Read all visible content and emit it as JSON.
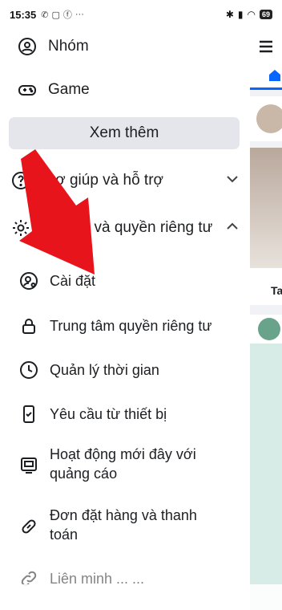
{
  "status_bar": {
    "time": "15:35",
    "battery": "69"
  },
  "menu": {
    "groups": "Nhóm",
    "game": "Game",
    "see_more": "Xem thêm",
    "help": "Trợ giúp và hỗ trợ",
    "settings_privacy": "Cài đặt và quyền riêng tư"
  },
  "submenu": [
    {
      "label": "Cài đặt",
      "icon": "user-gear-icon"
    },
    {
      "label": "Trung tâm quyền riêng tư",
      "icon": "lock-icon"
    },
    {
      "label": "Quản lý thời gian",
      "icon": "clock-icon"
    },
    {
      "label": "Yêu cầu từ thiết bị",
      "icon": "phone-check-icon"
    },
    {
      "label": "Hoạt động mới đây với",
      "label2": "quảng cáo",
      "icon": "ad-screen-icon"
    },
    {
      "label": "Đơn đặt hàng và thanh",
      "label2": "toán",
      "icon": "tag-icon"
    },
    {
      "label": "Liên minh ... ...",
      "icon": "link-icon"
    }
  ],
  "right_panel": {
    "story_label": "Ta"
  },
  "colors": {
    "accent": "#0866ff",
    "arrow": "#e8141b",
    "button_bg": "#e4e6eb"
  }
}
